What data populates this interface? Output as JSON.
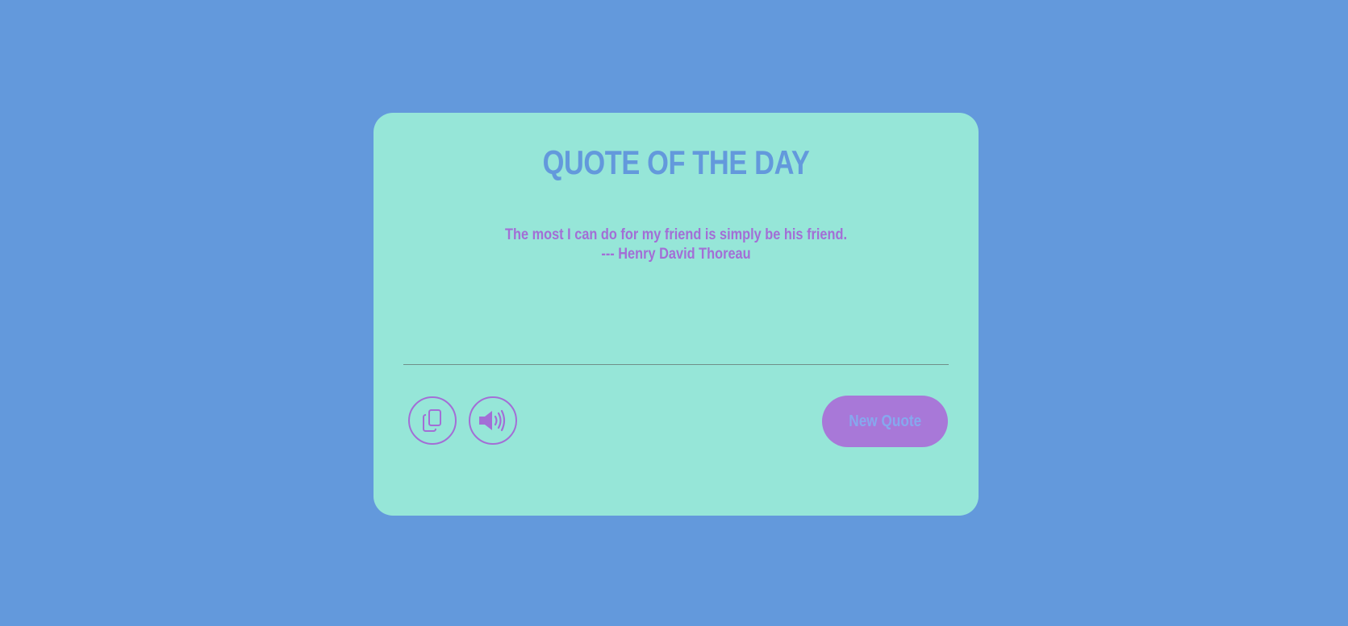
{
  "card": {
    "title": "QUOTE OF THE DAY",
    "quote_text": "The most I can do for my friend is simply be his friend.",
    "quote_author": "--- Henry David Thoreau"
  },
  "actions": {
    "copy_icon": "copy-icon",
    "speak_icon": "speaker-icon",
    "new_quote_label": "New Quote"
  },
  "colors": {
    "background": "#6399dc",
    "card": "#96e6d8",
    "accent": "#a36ed6",
    "title": "#6399dc",
    "button_text": "#86a8ee"
  }
}
